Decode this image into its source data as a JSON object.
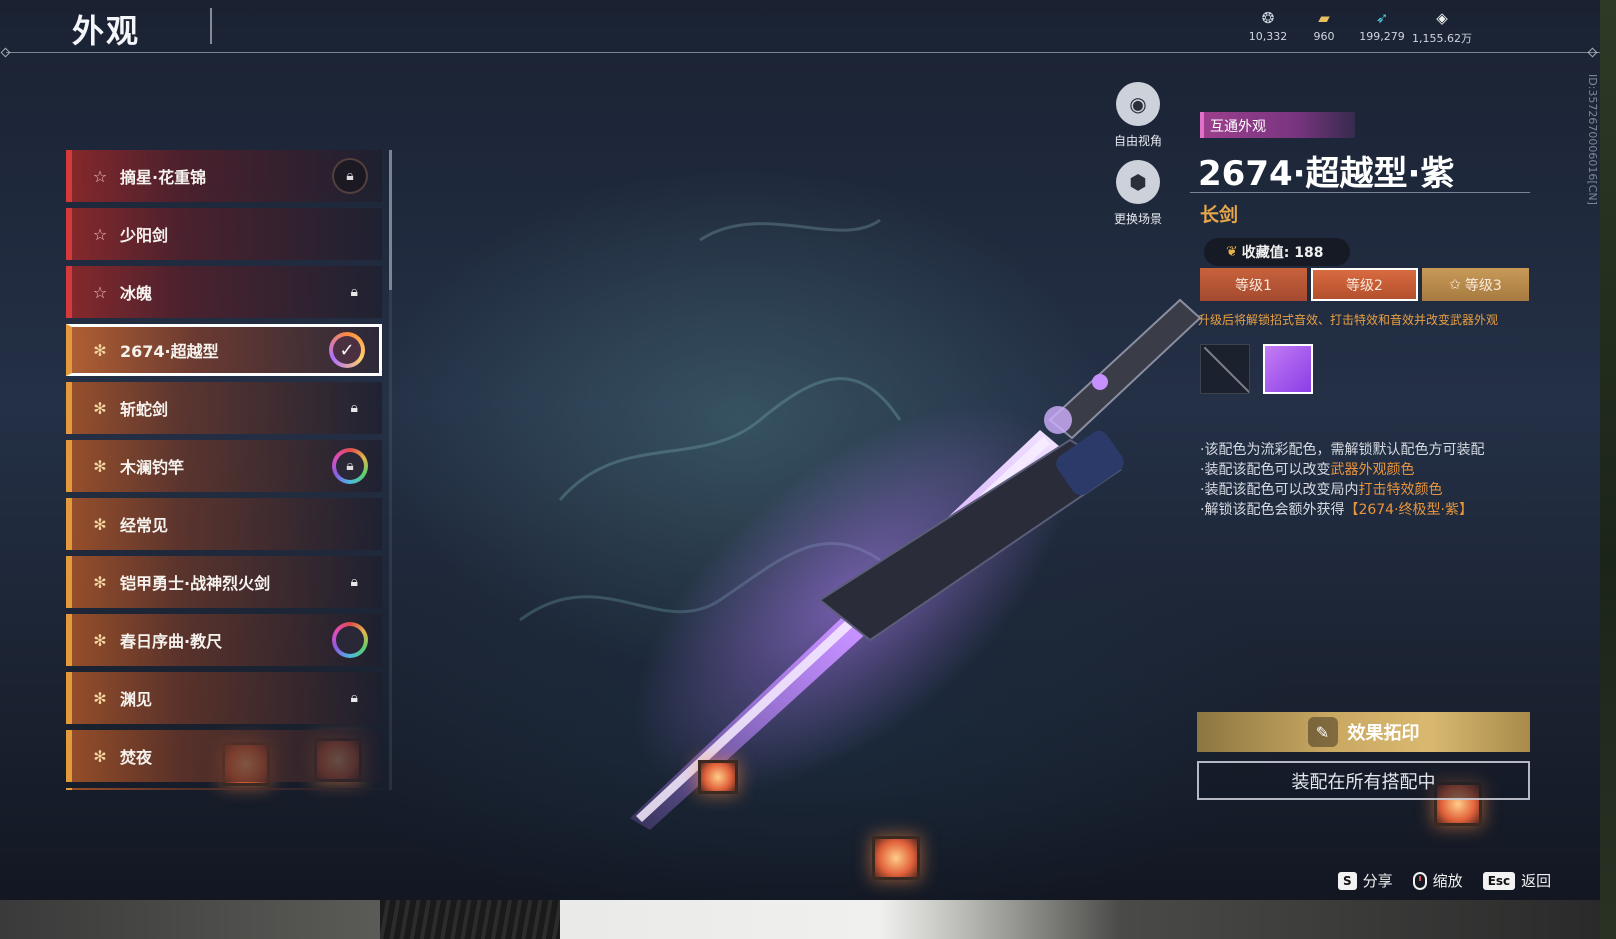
{
  "header": {
    "title": "外观"
  },
  "currencies": [
    {
      "icon": "jade-currency-icon",
      "value": "10,332"
    },
    {
      "icon": "gold-ingot-icon",
      "value": "960"
    },
    {
      "icon": "feather-currency-icon",
      "value": "199,279"
    },
    {
      "icon": "diamond-currency-icon",
      "value": "1,155.62万"
    }
  ],
  "list": {
    "items": [
      {
        "name": "摘星·花重锦",
        "tier": "red",
        "status": "lock-dark"
      },
      {
        "name": "少阳剑",
        "tier": "red",
        "status": "none"
      },
      {
        "name": "冰魄",
        "tier": "red",
        "status": "lock"
      },
      {
        "name": "2674·超越型",
        "tier": "gold",
        "status": "check",
        "selected": true
      },
      {
        "name": "斩蛇剑",
        "tier": "gold",
        "status": "lock"
      },
      {
        "name": "木澜钓竿",
        "tier": "gold",
        "status": "lock-ring"
      },
      {
        "name": "经常见",
        "tier": "gold",
        "status": "none"
      },
      {
        "name": "铠甲勇士·战神烈火剑",
        "tier": "gold",
        "status": "lock"
      },
      {
        "name": "春日序曲·教尺",
        "tier": "gold",
        "status": "ring"
      },
      {
        "name": "渊见",
        "tier": "gold",
        "status": "lock"
      },
      {
        "name": "焚夜",
        "tier": "gold",
        "status": "none"
      }
    ]
  },
  "tools": {
    "free_view": "自由视角",
    "change_scene": "更换场景"
  },
  "detail": {
    "tag": "互通外观",
    "title": "2674·超越型·紫",
    "type": "长剑",
    "collection_label": "收藏值: 188",
    "levels": [
      "等级1",
      "等级2",
      "等级3"
    ],
    "hint": "升级后将解锁招式音效、打击特效和音效并改变武器外观",
    "desc": [
      {
        "pre": "·该配色为流彩配色，需解锁默认配色方可装配",
        "hl": "",
        "post": ""
      },
      {
        "pre": "·装配该配色可以改变",
        "hl": "武器外观颜色",
        "post": ""
      },
      {
        "pre": "·装配该配色可以改变局内",
        "hl": "打击特效颜色",
        "post": ""
      },
      {
        "pre": "·解锁该配色会额外获得",
        "hl": "【2674·终极型·紫】",
        "post": ""
      }
    ],
    "seal_button": "效果拓印",
    "equip_button": "装配在所有搭配中",
    "id_text": "ID:3572670006016[CN]"
  },
  "hotkeys": {
    "share_key": "S",
    "share": "分享",
    "zoom": "缩放",
    "back_key": "Esc",
    "back": "返回"
  },
  "colors": {
    "red_tier": "#d43a3a",
    "gold_tier": "#e29a3c",
    "accent_orange": "#e8a64a",
    "purple_swatch": "#a45cf0"
  }
}
